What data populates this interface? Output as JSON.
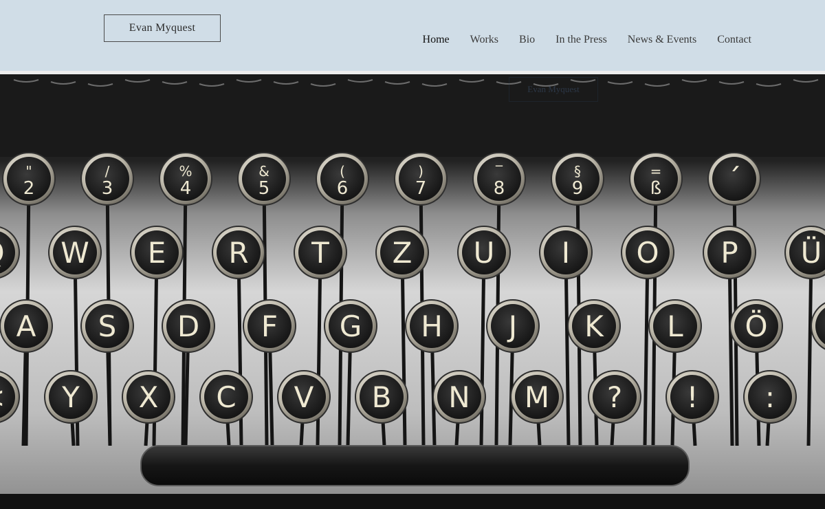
{
  "header": {
    "logo_text": "Evan Myquest",
    "nav": [
      {
        "label": "Home",
        "active": true
      },
      {
        "label": "Works",
        "active": false
      },
      {
        "label": "Bio",
        "active": false
      },
      {
        "label": "In the Press",
        "active": false
      },
      {
        "label": "News & Events",
        "active": false
      },
      {
        "label": "Contact",
        "active": false
      }
    ]
  },
  "hero": {
    "image_subject": "typewriter-keyboard",
    "ghost_label": "Evan Myquest",
    "rows": [
      [
        "\"2",
        "/3",
        "%4",
        "&5",
        "(6",
        ")7",
        "‾8",
        "§9",
        "=ß",
        "´"
      ],
      [
        "Q",
        "W",
        "E",
        "R",
        "T",
        "Z",
        "U",
        "I",
        "O",
        "P",
        "Ü"
      ],
      [
        "A",
        "S",
        "D",
        "F",
        "G",
        "H",
        "J",
        "K",
        "L",
        "Ö",
        "Ä"
      ],
      [
        "<",
        "Y",
        "X",
        "C",
        "V",
        "B",
        "N",
        "M",
        "?",
        "!",
        ":"
      ]
    ]
  },
  "colors": {
    "header_bg": "#d0dde7",
    "key_face": "#2a2a2a",
    "key_ring": "#c8c3b6",
    "key_glyph": "#efe9d2"
  }
}
